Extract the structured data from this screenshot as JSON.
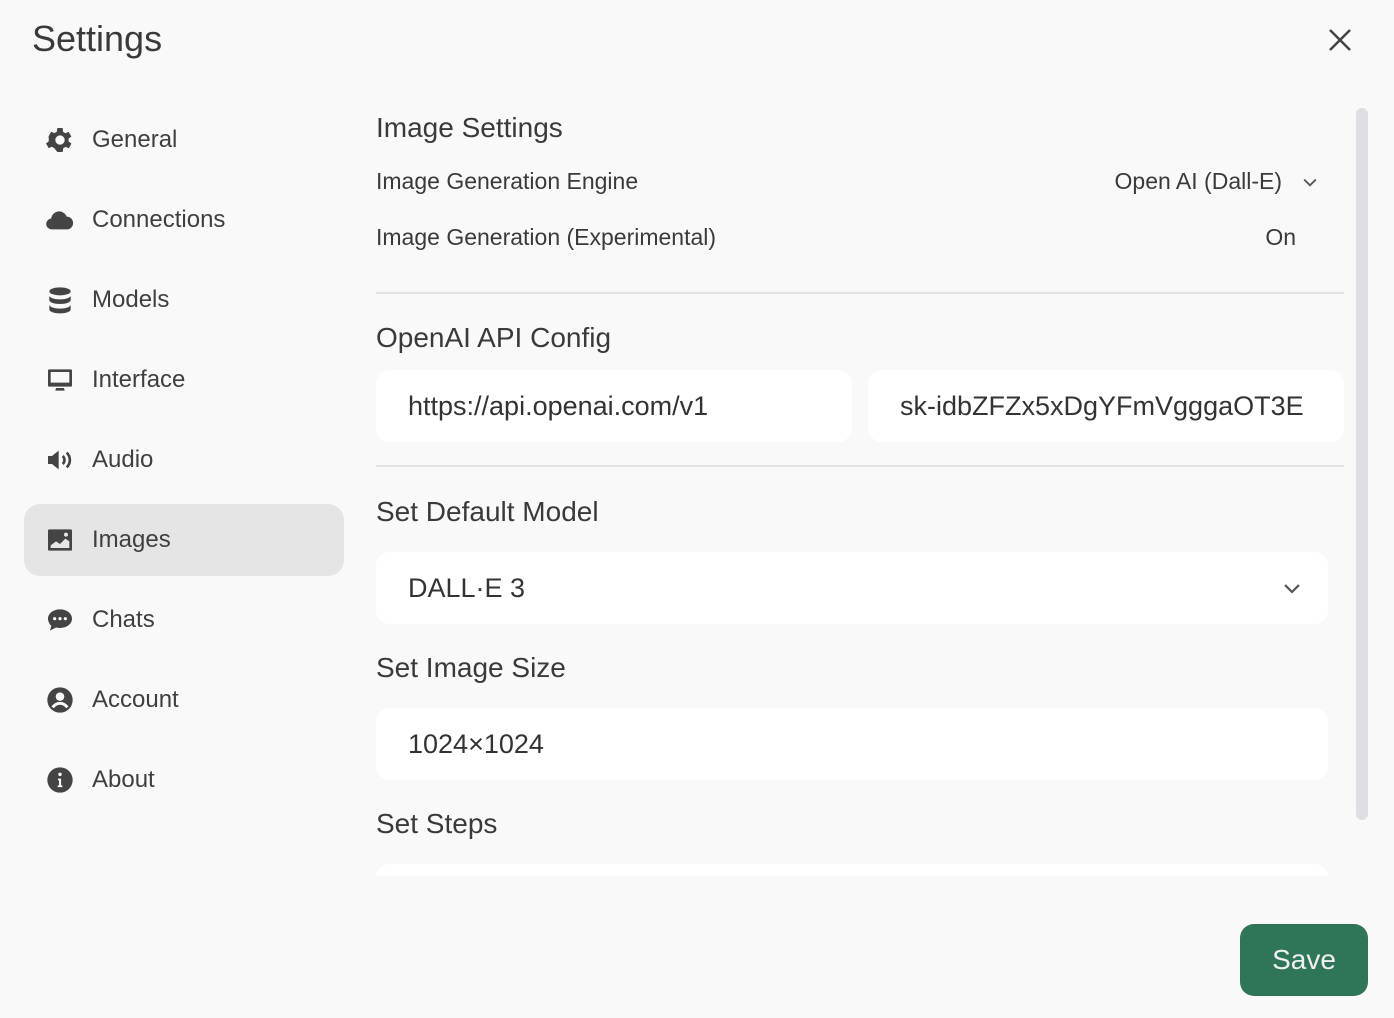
{
  "header": {
    "title": "Settings",
    "close_icon": "close-icon"
  },
  "sidebar": {
    "items": [
      {
        "label": "General",
        "icon": "gear-icon"
      },
      {
        "label": "Connections",
        "icon": "cloud-icon"
      },
      {
        "label": "Models",
        "icon": "database-icon"
      },
      {
        "label": "Interface",
        "icon": "monitor-icon"
      },
      {
        "label": "Audio",
        "icon": "speaker-icon"
      },
      {
        "label": "Images",
        "icon": "image-icon",
        "active": true
      },
      {
        "label": "Chats",
        "icon": "chat-bubble-icon"
      },
      {
        "label": "Account",
        "icon": "user-circle-icon"
      },
      {
        "label": "About",
        "icon": "info-icon"
      }
    ]
  },
  "main": {
    "image_settings": {
      "heading": "Image Settings",
      "engine_label": "Image Generation Engine",
      "engine_value": "Open AI (Dall-E)",
      "experimental_label": "Image Generation (Experimental)",
      "experimental_value": "On"
    },
    "openai": {
      "heading": "OpenAI API Config",
      "base_url": "https://api.openai.com/v1",
      "api_key": "sk-idbZFZx5xDgYFmVgggaOT3E"
    },
    "default_model": {
      "heading": "Set Default Model",
      "value": "DALL·E 3"
    },
    "image_size": {
      "heading": "Set Image Size",
      "value": "1024×1024"
    },
    "steps": {
      "heading": "Set Steps"
    }
  },
  "footer": {
    "save_label": "Save"
  },
  "colors": {
    "accent": "#2f7557",
    "active_item": "#e5e5e5",
    "background": "#f9f9f9"
  }
}
